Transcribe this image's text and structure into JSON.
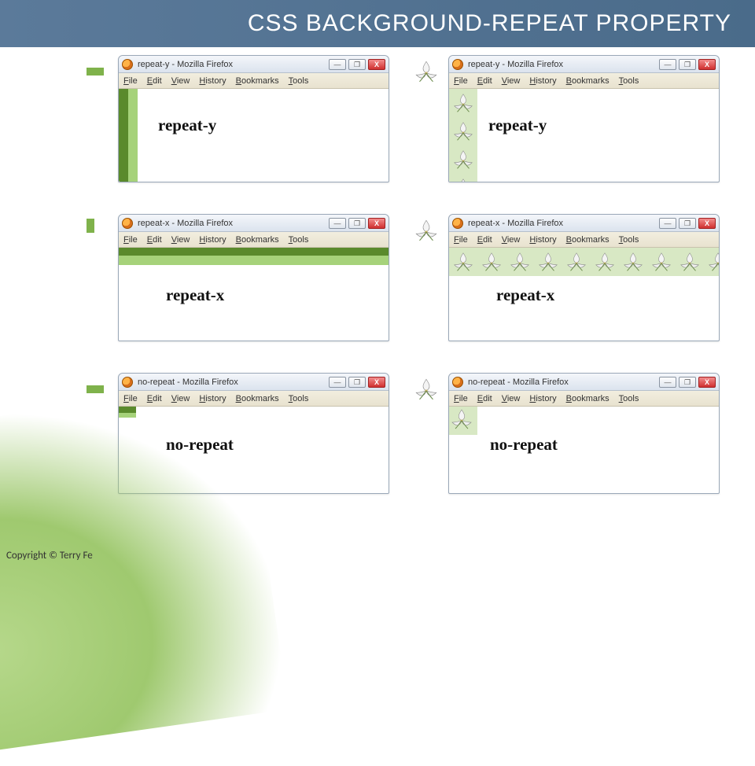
{
  "title": "CSS BACKGROUND-REPEAT PROPERTY",
  "footer": "Copyright © Terry Fe",
  "menus": {
    "file": "File",
    "edit": "Edit",
    "view": "View",
    "history": "History",
    "bookmarks": "Bookmarks",
    "tools": "Tools"
  },
  "winbtn": {
    "min": "—",
    "max": "❐",
    "close": "X"
  },
  "examples": {
    "ry_green": {
      "wintitle": "repeat-y - Mozilla Firefox",
      "label": "repeat-y"
    },
    "ry_trillium": {
      "wintitle": "repeat-y - Mozilla Firefox",
      "label": "repeat-y"
    },
    "rx_green": {
      "wintitle": "repeat-x - Mozilla Firefox",
      "label": "repeat-x"
    },
    "rx_trillium": {
      "wintitle": "repeat-x - Mozilla Firefox",
      "label": "repeat-x"
    },
    "nr_green": {
      "wintitle": "no-repeat - Mozilla Firefox",
      "label": "no-repeat"
    },
    "nr_trillium": {
      "wintitle": "no-repeat - Mozilla Firefox",
      "label": "no-repeat"
    }
  }
}
